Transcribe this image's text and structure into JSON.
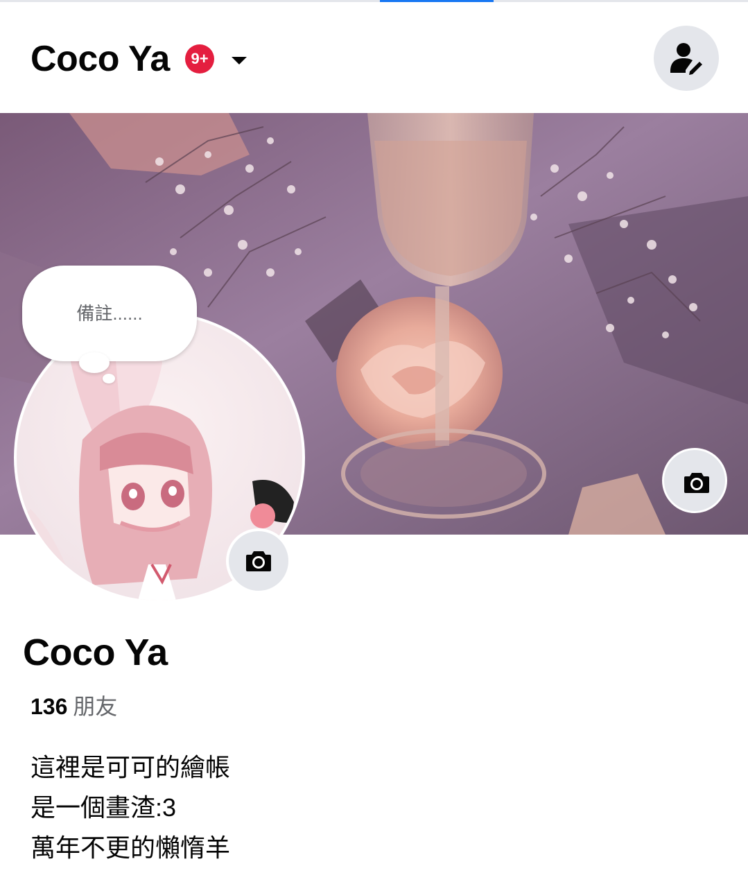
{
  "header": {
    "title": "Coco Ya",
    "notification_badge": "9+",
    "dropdown_icon": "caret-down-icon",
    "profile_button_icon": "edit-person-icon"
  },
  "cover": {
    "camera_icon": "camera-icon"
  },
  "avatar": {
    "note_placeholder": "備註......",
    "camera_icon": "camera-icon"
  },
  "profile": {
    "name": "Coco Ya",
    "friends_count": "136",
    "friends_label": "朋友",
    "bio": [
      "這裡是可可的繪帳",
      "是一個畫渣:3",
      "萬年不更的懶惰羊"
    ]
  },
  "colors": {
    "badge": "#e41e3f",
    "accent": "#1877f2",
    "button_bg": "#e4e6eb",
    "secondary_text": "#65676b"
  }
}
